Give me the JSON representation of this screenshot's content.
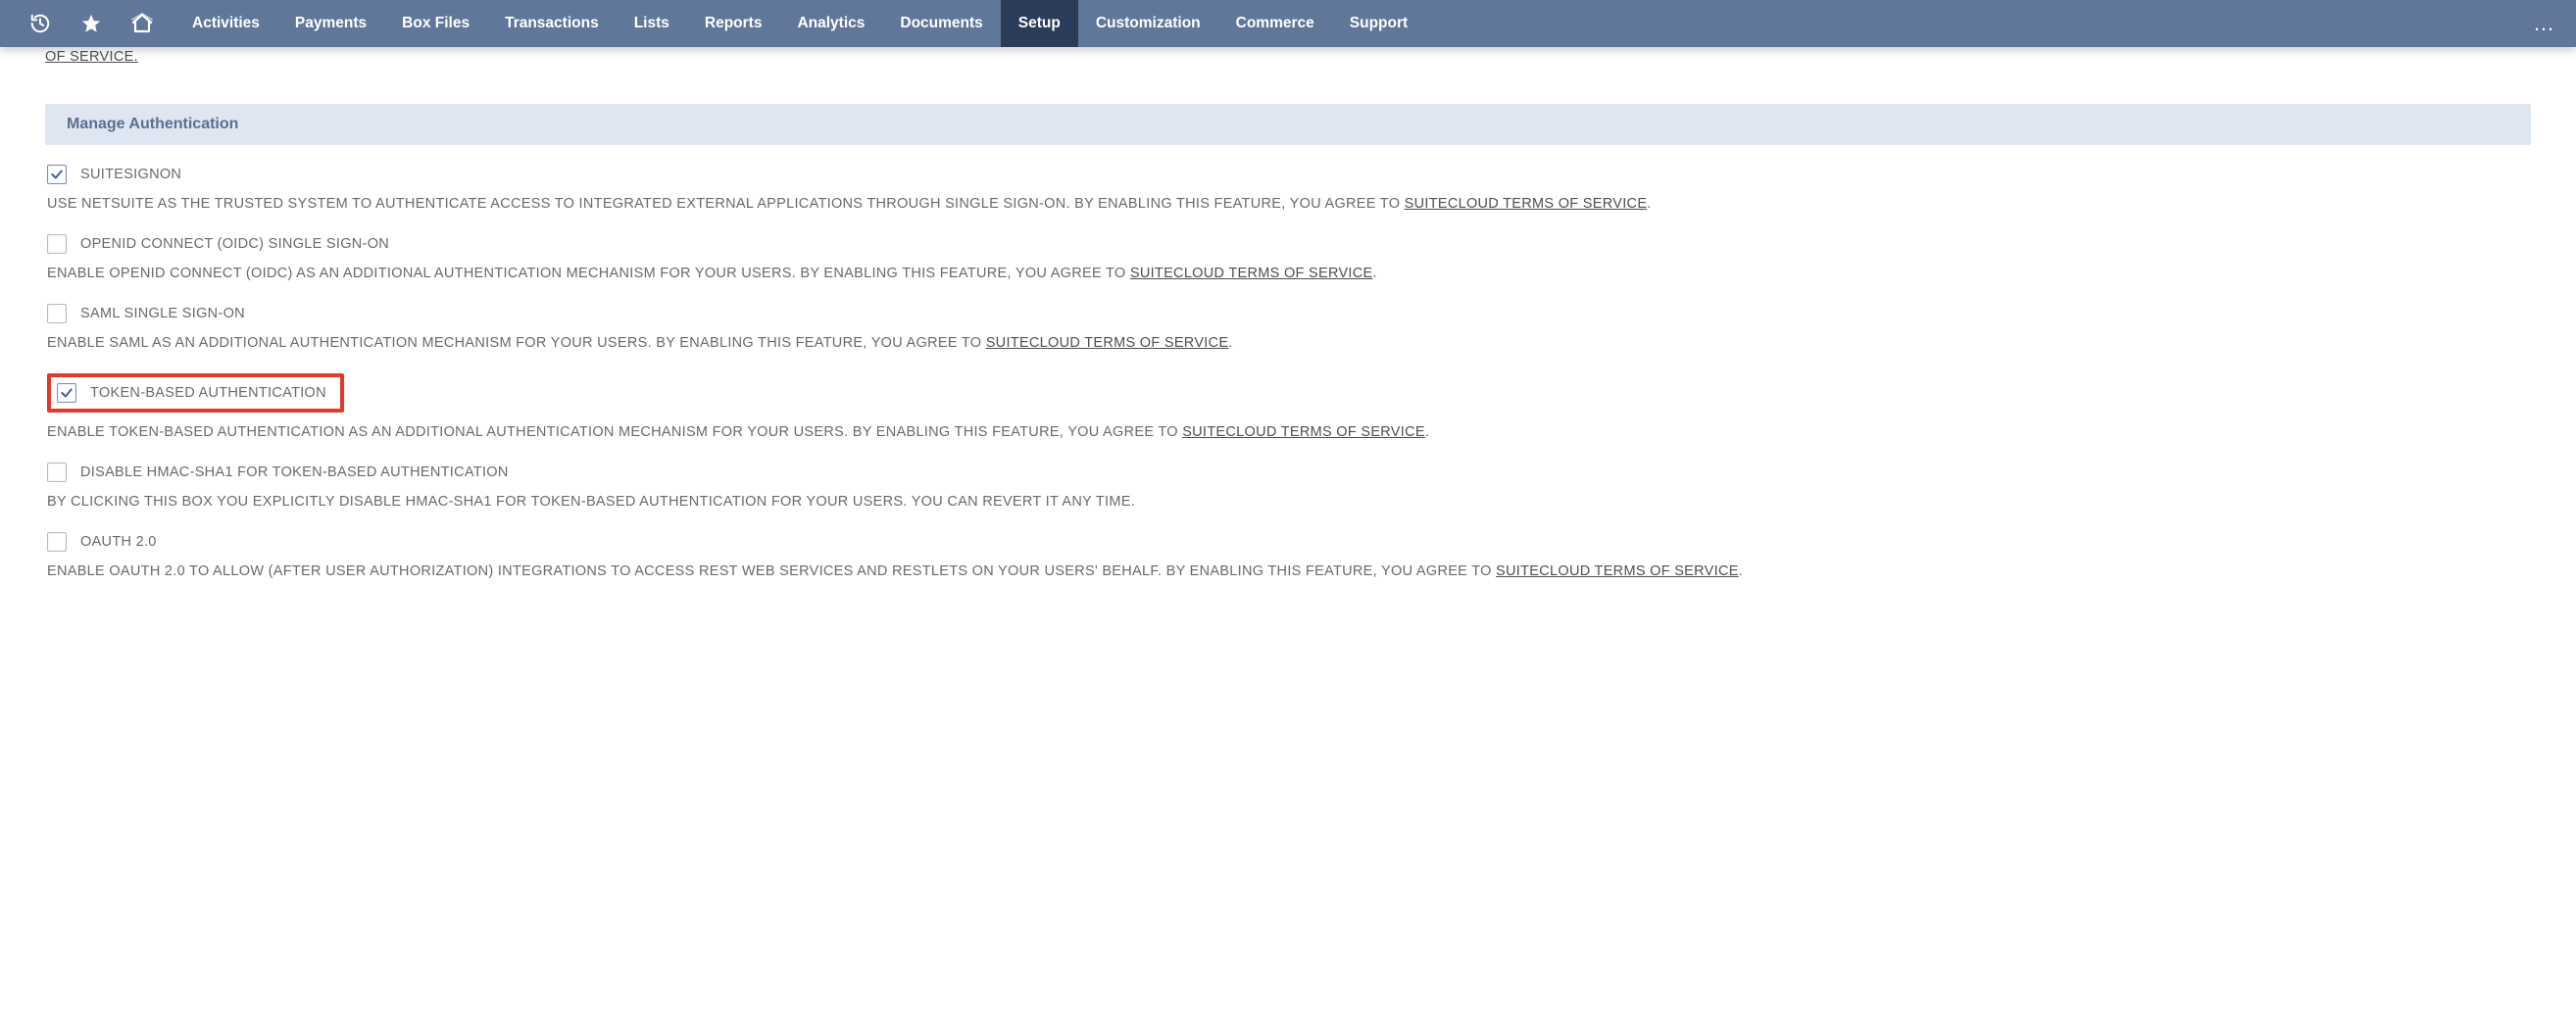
{
  "nav": {
    "items": [
      {
        "label": "Activities",
        "active": false
      },
      {
        "label": "Payments",
        "active": false
      },
      {
        "label": "Box Files",
        "active": false
      },
      {
        "label": "Transactions",
        "active": false
      },
      {
        "label": "Lists",
        "active": false
      },
      {
        "label": "Reports",
        "active": false
      },
      {
        "label": "Analytics",
        "active": false
      },
      {
        "label": "Documents",
        "active": false
      },
      {
        "label": "Setup",
        "active": true
      },
      {
        "label": "Customization",
        "active": false
      },
      {
        "label": "Commerce",
        "active": false
      },
      {
        "label": "Support",
        "active": false
      }
    ],
    "more": "…"
  },
  "truncated_top": "OF SERVICE",
  "section": {
    "title": "Manage Authentication"
  },
  "tos_link": "SUITECLOUD TERMS OF SERVICE",
  "features": [
    {
      "key": "suitesignon",
      "checked": true,
      "highlight": false,
      "label": "SUITESIGNON",
      "desc_pre": "USE NETSUITE AS THE TRUSTED SYSTEM TO AUTHENTICATE ACCESS TO INTEGRATED EXTERNAL APPLICATIONS THROUGH SINGLE SIGN-ON. BY ENABLING THIS FEATURE, YOU AGREE TO ",
      "desc_post": "."
    },
    {
      "key": "oidc",
      "checked": false,
      "highlight": false,
      "label": "OPENID CONNECT (OIDC) SINGLE SIGN-ON",
      "desc_pre": "ENABLE OPENID CONNECT (OIDC) AS AN ADDITIONAL AUTHENTICATION MECHANISM FOR YOUR USERS. BY ENABLING THIS FEATURE, YOU AGREE TO ",
      "desc_post": "."
    },
    {
      "key": "saml",
      "checked": false,
      "highlight": false,
      "label": "SAML SINGLE SIGN-ON",
      "desc_pre": "ENABLE SAML AS AN ADDITIONAL AUTHENTICATION MECHANISM FOR YOUR USERS. BY ENABLING THIS FEATURE, YOU AGREE TO ",
      "desc_post": "."
    },
    {
      "key": "tba",
      "checked": true,
      "highlight": true,
      "label": "TOKEN-BASED AUTHENTICATION",
      "desc_pre": "ENABLE TOKEN-BASED AUTHENTICATION AS AN ADDITIONAL AUTHENTICATION MECHANISM FOR YOUR USERS. BY ENABLING THIS FEATURE, YOU AGREE TO ",
      "desc_post": "."
    },
    {
      "key": "hmac",
      "checked": false,
      "highlight": false,
      "label": "DISABLE HMAC-SHA1 FOR TOKEN-BASED AUTHENTICATION",
      "desc_pre": "BY CLICKING THIS BOX YOU EXPLICITLY DISABLE HMAC-SHA1 FOR TOKEN-BASED AUTHENTICATION FOR YOUR USERS. YOU CAN REVERT IT ANY TIME.",
      "desc_post": "",
      "no_link": true
    },
    {
      "key": "oauth2",
      "checked": false,
      "highlight": false,
      "label": "OAUTH 2.0",
      "desc_pre": "ENABLE OAUTH 2.0 TO ALLOW (AFTER USER AUTHORIZATION) INTEGRATIONS TO ACCESS REST WEB SERVICES AND RESTLETS ON YOUR USERS' BEHALF. BY ENABLING THIS FEATURE, YOU AGREE TO ",
      "desc_post": "."
    }
  ]
}
